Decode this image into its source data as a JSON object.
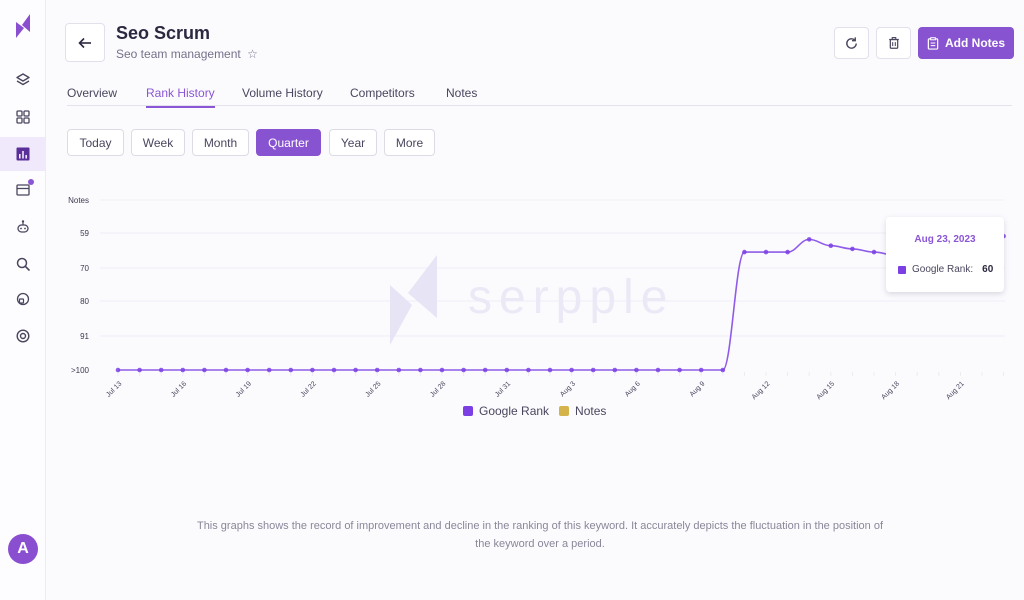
{
  "sidebar": {
    "logo": "serpple-logo",
    "items": [
      {
        "icon": "layers-icon",
        "active": false
      },
      {
        "icon": "grid-icon",
        "active": false
      },
      {
        "icon": "bar-chart-icon",
        "active": true
      },
      {
        "icon": "browser-window-icon",
        "active": false,
        "badge": true
      },
      {
        "icon": "robot-icon",
        "active": false
      },
      {
        "icon": "search-icon",
        "active": false
      },
      {
        "icon": "globe-icon",
        "active": false
      },
      {
        "icon": "settings-icon",
        "active": false
      }
    ],
    "avatar_initial": "A"
  },
  "header": {
    "back_icon": "arrow-left-icon",
    "title": "Seo Scrum",
    "subtitle": "Seo team management",
    "star_icon": "star-icon",
    "refresh_icon": "refresh-icon",
    "delete_icon": "trash-icon",
    "add_notes_label": "Add Notes",
    "add_notes_icon": "notes-icon"
  },
  "tabs": [
    {
      "label": "Overview",
      "active": false
    },
    {
      "label": "Rank History",
      "active": true
    },
    {
      "label": "Volume History",
      "active": false
    },
    {
      "label": "Competitors",
      "active": false
    },
    {
      "label": "Notes",
      "active": false
    }
  ],
  "ranges": [
    {
      "label": "Today",
      "active": false
    },
    {
      "label": "Week",
      "active": false
    },
    {
      "label": "Month",
      "active": false
    },
    {
      "label": "Quarter",
      "active": true
    },
    {
      "label": "Year",
      "active": false
    },
    {
      "label": "More",
      "active": false
    }
  ],
  "colors": {
    "accent": "#8853d1",
    "series_google_rank": "#7b3fe4",
    "series_notes": "#d4b44a"
  },
  "tooltip": {
    "date": "Aug 23, 2023",
    "label": "Google Rank:",
    "value": "60"
  },
  "watermark": "serpple",
  "description": "This graphs shows the record of improvement and decline in the ranking of this keyword. It accurately depicts the fluctuation in the position of the keyword over a period.",
  "chart_data": {
    "type": "line",
    "title": "",
    "xlabel": "",
    "ylabel": "",
    "y_top_label": "Notes",
    "y_inverted": true,
    "y_ticks": [
      "59",
      "70",
      "80",
      "91",
      ">100"
    ],
    "y_tick_values": [
      59,
      70,
      80,
      91,
      101
    ],
    "ylim": [
      59,
      101
    ],
    "x_tick_labels": [
      "Jul 13",
      "Jul 16",
      "Jul 19",
      "Jul 22",
      "Jul 25",
      "Jul 28",
      "Jul 31",
      "Aug 3",
      "Aug 6",
      "Aug 9",
      "Aug 12",
      "Aug 15",
      "Aug 18",
      "Aug 21"
    ],
    "x": [
      "Jul 13",
      "Jul 14",
      "Jul 15",
      "Jul 16",
      "Jul 17",
      "Jul 18",
      "Jul 19",
      "Jul 20",
      "Jul 21",
      "Jul 22",
      "Jul 23",
      "Jul 24",
      "Jul 25",
      "Jul 26",
      "Jul 27",
      "Jul 28",
      "Jul 29",
      "Jul 30",
      "Jul 31",
      "Aug 1",
      "Aug 2",
      "Aug 3",
      "Aug 4",
      "Aug 5",
      "Aug 6",
      "Aug 7",
      "Aug 8",
      "Aug 9",
      "Aug 10",
      "Aug 11",
      "Aug 12",
      "Aug 13",
      "Aug 14",
      "Aug 15",
      "Aug 16",
      "Aug 17",
      "Aug 18",
      "Aug 19",
      "Aug 20",
      "Aug 21",
      "Aug 22",
      "Aug 23"
    ],
    "series": [
      {
        "name": "Google Rank",
        "values": [
          101,
          101,
          101,
          101,
          101,
          101,
          101,
          101,
          101,
          101,
          101,
          101,
          101,
          101,
          101,
          101,
          101,
          101,
          101,
          101,
          101,
          101,
          101,
          101,
          101,
          101,
          101,
          101,
          101,
          65,
          65,
          65,
          61,
          63,
          64,
          65,
          66,
          67,
          66,
          64,
          62,
          60
        ]
      },
      {
        "name": "Notes",
        "values": []
      }
    ],
    "legend": [
      "Google Rank",
      "Notes"
    ],
    "legend_position": "bottom-center",
    "grid": true
  }
}
